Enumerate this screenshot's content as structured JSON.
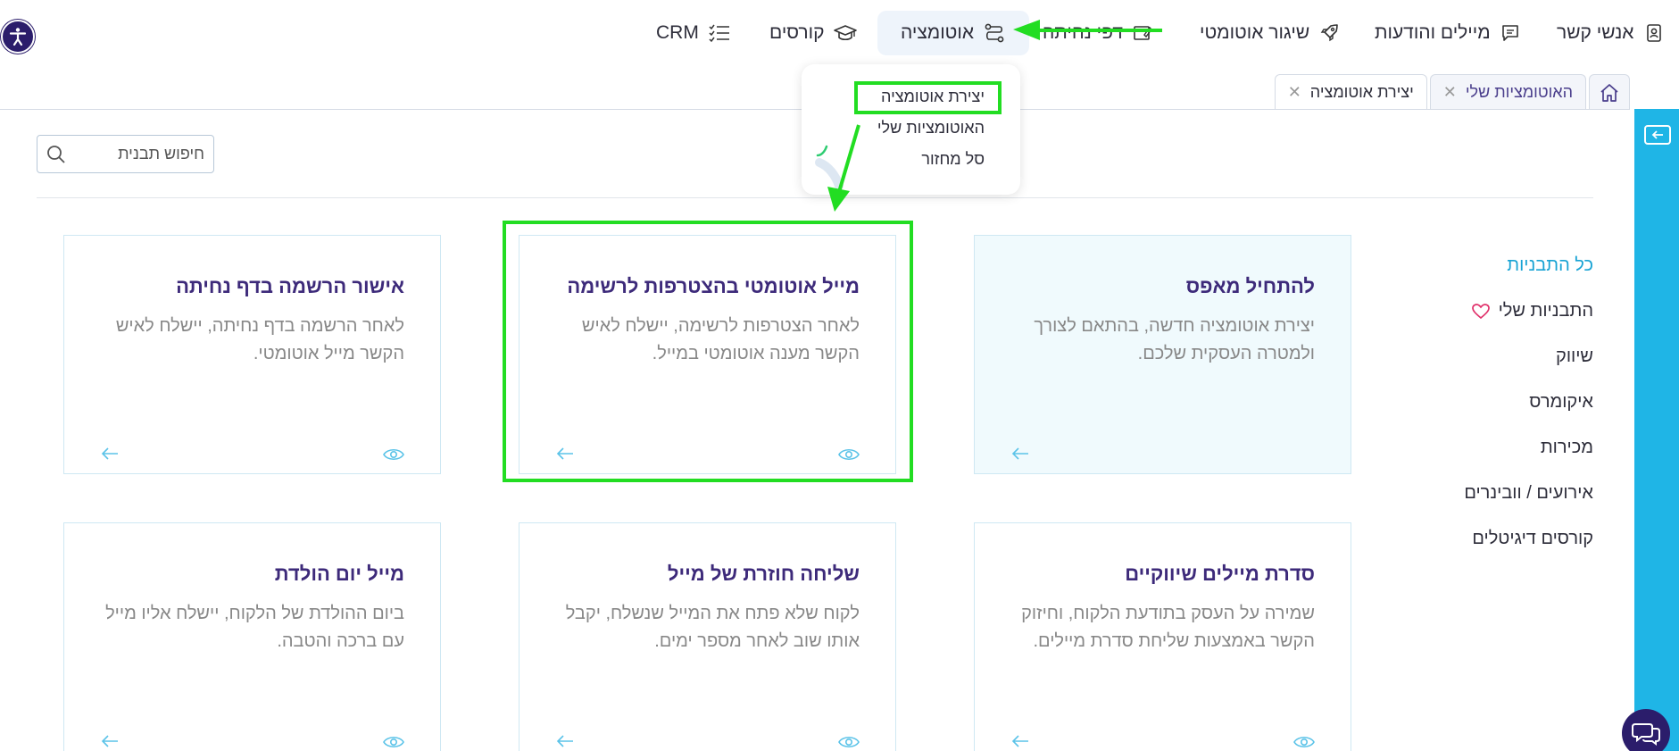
{
  "nav": {
    "contacts": "אנשי קשר",
    "emails": "מיילים והודעות",
    "auto_launch": "שיגור אוטומטי",
    "landing": "דפי נחיתה",
    "automation": "אוטומציה",
    "courses": "קורסים",
    "crm": "CRM"
  },
  "dropdown": {
    "create": "יצירת אוטומציה",
    "my_automations": "האוטומציות שלי",
    "trash": "סל מחזור"
  },
  "tabs": [
    {
      "label": "האוטומציות שלי"
    },
    {
      "label": "יצירת אוטומציה"
    }
  ],
  "search": {
    "placeholder": "חיפוש תבנית"
  },
  "sidebar": [
    {
      "label": "כל התבניות"
    },
    {
      "label": "התבניות שלי"
    },
    {
      "label": "שיווק"
    },
    {
      "label": "איקומרס"
    },
    {
      "label": "מכירות"
    },
    {
      "label": "אירועים / וובינרים"
    },
    {
      "label": "קורסים דיגיטלים"
    }
  ],
  "cards": [
    {
      "title": "להתחיל מאפס",
      "desc": "יצירת אוטומציה חדשה, בהתאם לצורך ולמטרה העסקית שלכם."
    },
    {
      "title": "מייל אוטומטי בהצטרפות לרשימה",
      "desc": "לאחר הצטרפות לרשימה, יישלח לאיש הקשר מענה אוטומטי במייל."
    },
    {
      "title": "אישור הרשמה בדף נחיתה",
      "desc": "לאחר הרשמה בדף נחיתה, יישלח לאיש הקשר מייל אוטומטי."
    },
    {
      "title": "סדרת מיילים שיווקיים",
      "desc": "שמירה על העסק בתודעת הלקוח, וחיזוק הקשר באמצעות שליחת סדרת מיילים."
    },
    {
      "title": "שליחה חוזרת של מייל",
      "desc": "לקוח שלא פתח את המייל שנשלח, יקבל אותו שוב לאחר מספר ימים."
    },
    {
      "title": "מייל יום הולדת",
      "desc": "ביום ההולדת של הלקוח, יישלח אליו מייל עם ברכה והטבה."
    }
  ],
  "colors": {
    "accent": "#1fb5e6",
    "title_purple": "#3d2a7a",
    "annotation_green": "#22dd22"
  }
}
